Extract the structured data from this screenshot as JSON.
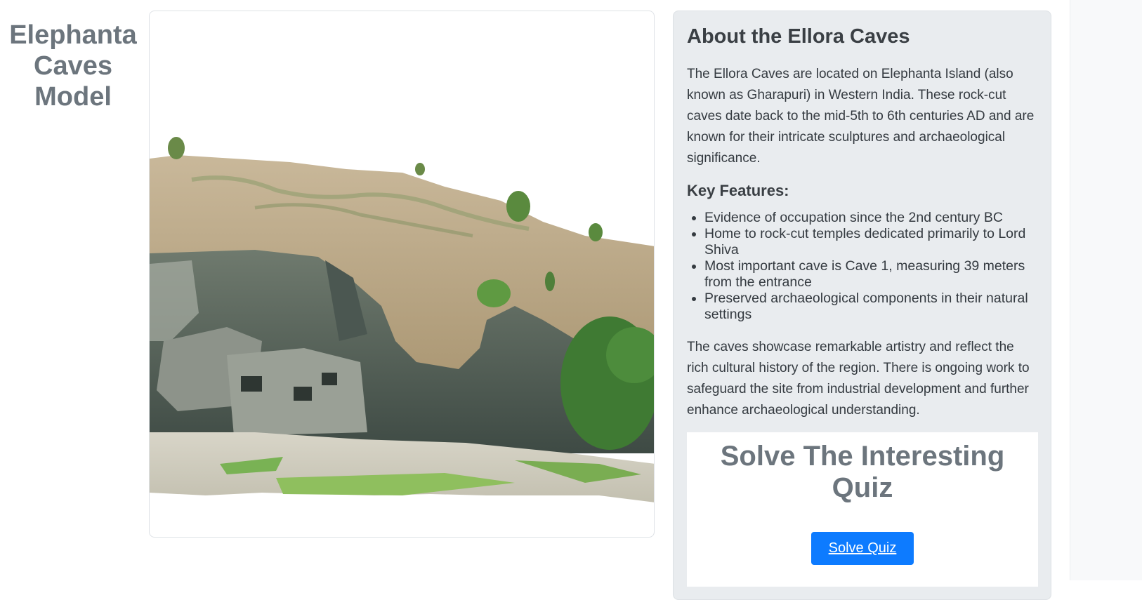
{
  "page": {
    "title": "Elephanta\nCaves\nModel"
  },
  "model_viewer": {
    "subject": "3D model of Ellora Caves"
  },
  "about": {
    "heading": "About the Ellora Caves",
    "intro": "The Ellora Caves are located on Elephanta Island (also known as Gharapuri) in Western India. These rock-cut caves date back to the mid-5th to 6th centuries AD and are known for their intricate sculptures and archaeological significance.",
    "features_heading": "Key Features:",
    "features": [
      "Evidence of occupation since the 2nd century BC",
      "Home to rock-cut temples dedicated primarily to Lord Shiva",
      "Most important cave is Cave 1, measuring 39 meters from the entrance",
      "Preserved archaeological components in their natural settings"
    ],
    "closing": "The caves showcase remarkable artistry and reflect the rich cultural history of the region. There is ongoing work to safeguard the site from industrial development and further enhance archaeological understanding."
  },
  "quiz": {
    "title": "Solve The Interesting Quiz",
    "button_label": "Solve Quiz",
    "button_color": "#0d7bff"
  },
  "colors": {
    "title_gray": "#6c757d",
    "panel_bg": "#e9ecef"
  }
}
